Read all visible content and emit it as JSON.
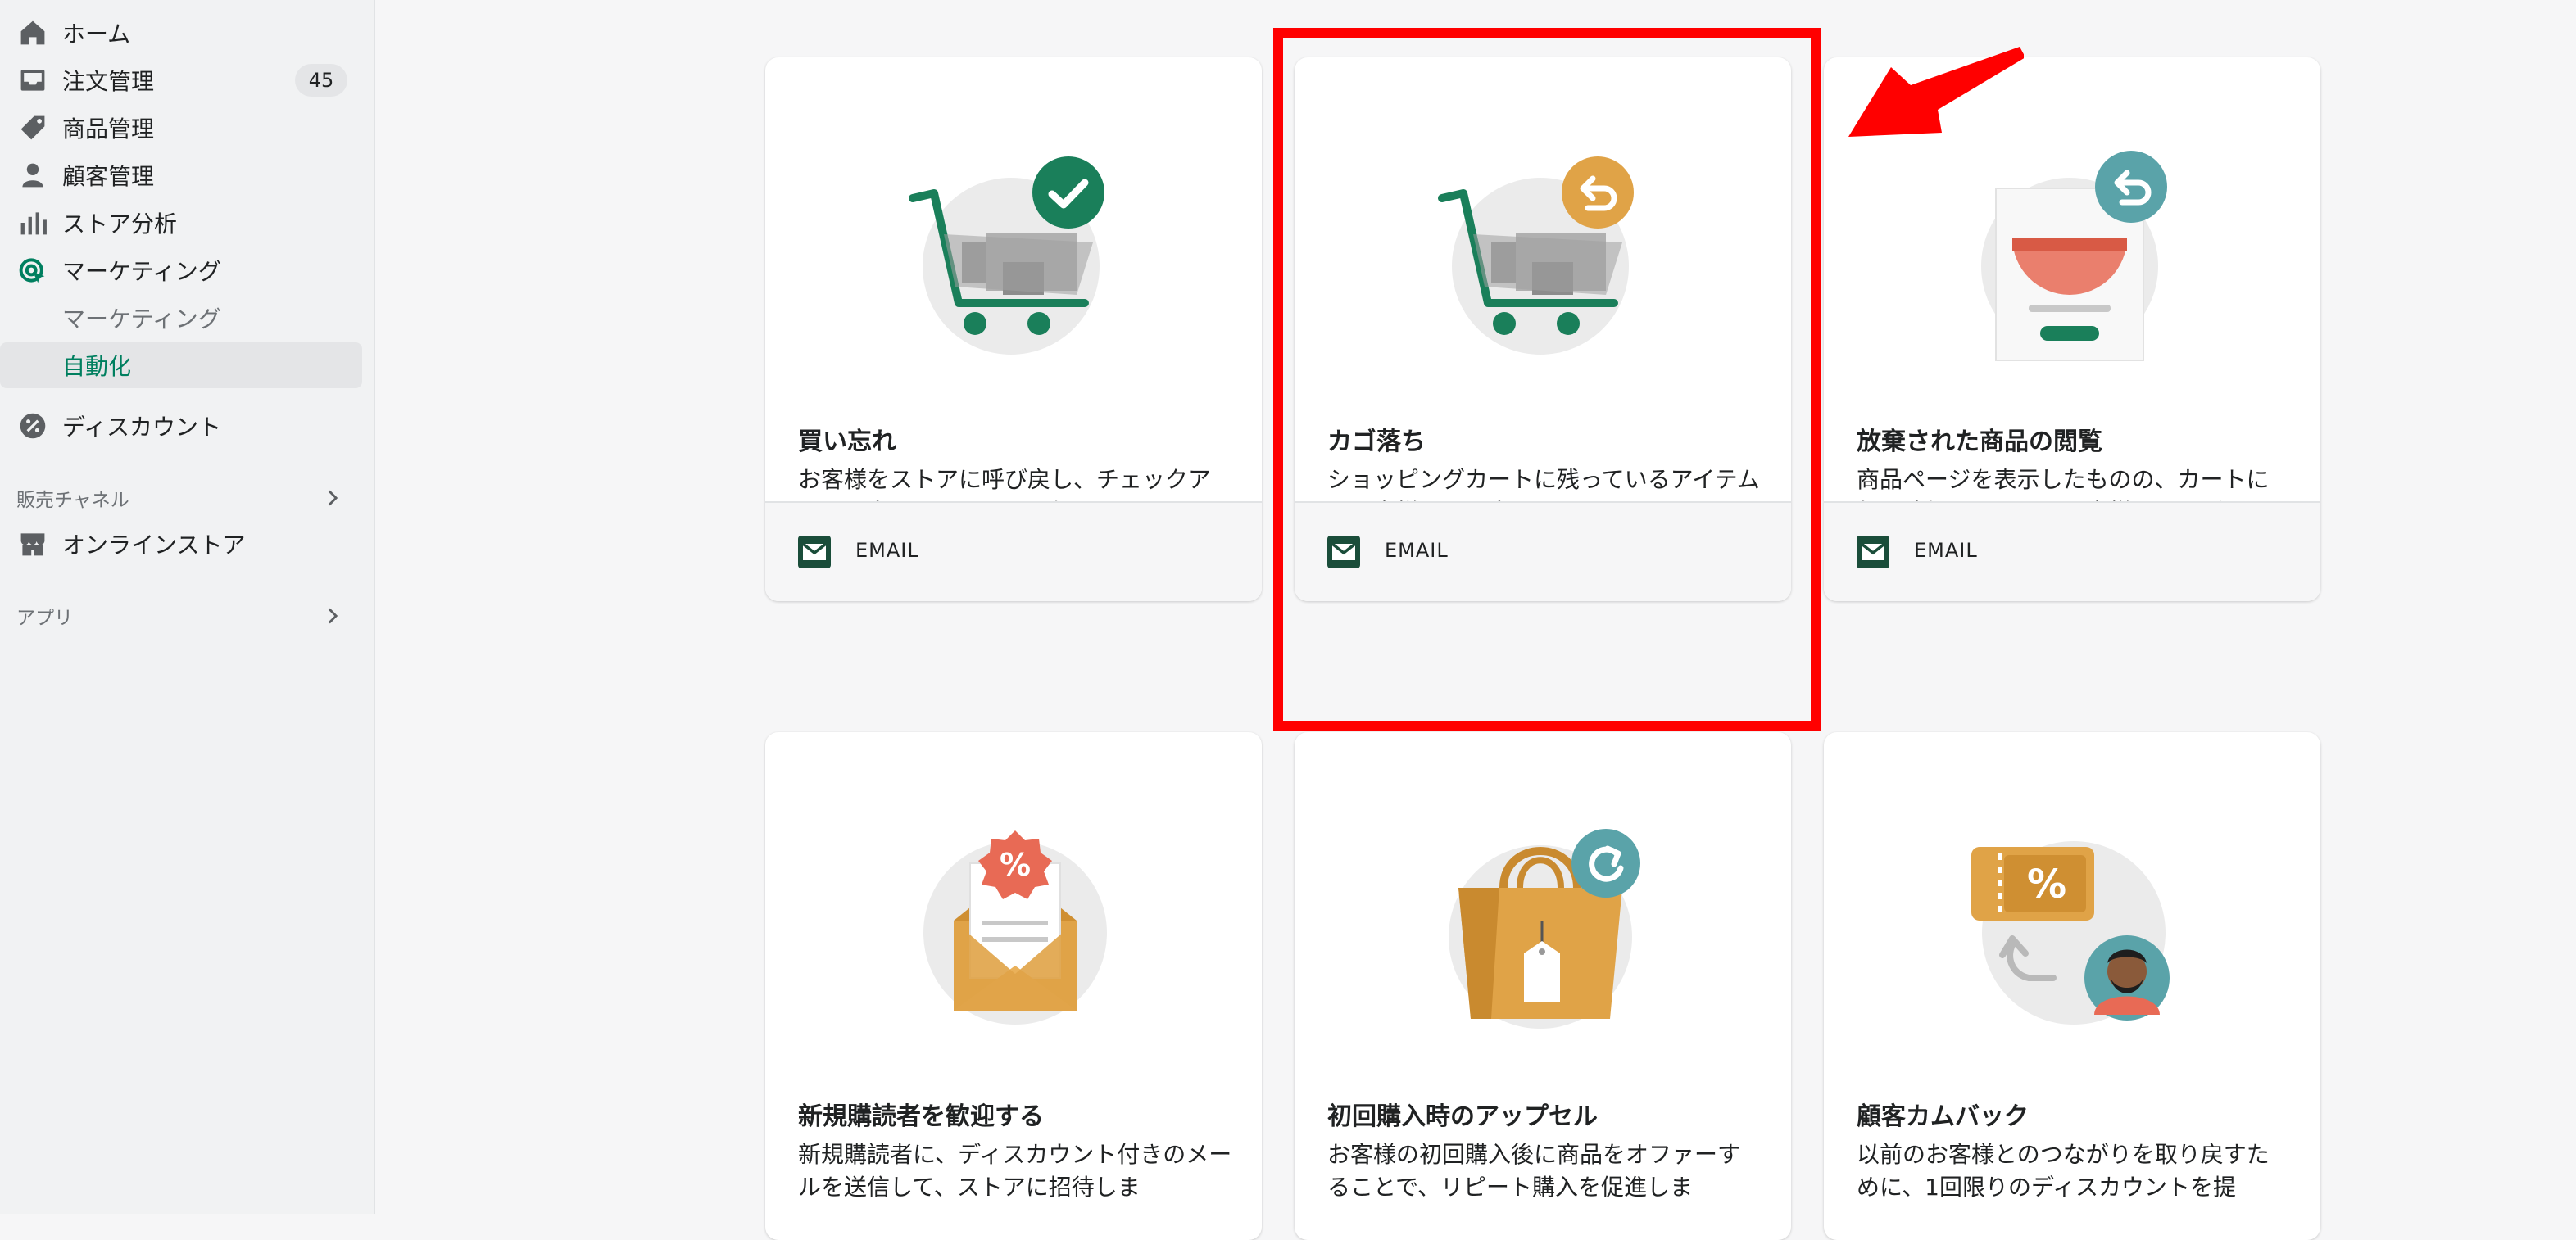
{
  "sidebar": {
    "items": [
      {
        "label": "ホーム",
        "icon": "home-icon"
      },
      {
        "label": "注文管理",
        "icon": "inbox-icon",
        "badge": "45"
      },
      {
        "label": "商品管理",
        "icon": "tag-icon"
      },
      {
        "label": "顧客管理",
        "icon": "person-icon"
      },
      {
        "label": "ストア分析",
        "icon": "bar-chart-icon"
      },
      {
        "label": "マーケティング",
        "icon": "marketing-target-icon"
      },
      {
        "label": "マーケティング"
      },
      {
        "label": "自動化",
        "active": true
      },
      {
        "label": "ディスカウント",
        "icon": "discount-icon"
      }
    ],
    "sales_channels": {
      "label": "販売チャネル",
      "items": [
        {
          "label": "オンラインストア",
          "icon": "store-icon"
        }
      ]
    },
    "apps": {
      "label": "アプリ"
    }
  },
  "cards": [
    {
      "title": "買い忘れ",
      "description": "お客様をストアに呼び戻し、チェックアウトを完了をするように促します。",
      "channel": "EMAIL",
      "illustration": "cart-check-illustration"
    },
    {
      "title": "カゴ落ち",
      "description": "ショッピングカートに残っているアイテムをお客様に思い出させましょう。",
      "channel": "EMAIL",
      "illustration": "cart-return-illustration"
    },
    {
      "title": "放棄された商品の閲覧",
      "description": "商品ページを表示したものの、カートに何も追加しなかったお客様のエンゲージメントを高めます。",
      "channel": "EMAIL",
      "illustration": "product-page-return-illustration"
    },
    {
      "title": "新規購読者を歓迎する",
      "description": "新規購読者に、ディスカウント付きのメールを送信して、ストアに招待しま",
      "illustration": "envelope-discount-illustration"
    },
    {
      "title": "初回購入時のアップセル",
      "description": "お客様の初回購入後に商品をオファーすることで、リピート購入を促進しま",
      "illustration": "shopping-bag-illustration"
    },
    {
      "title": "顧客カムバック",
      "description": "以前のお客様とのつながりを取り戻すために、1回限りのディスカウントを提",
      "illustration": "coupon-customer-illustration"
    }
  ],
  "colors": {
    "accent_green": "#007f5f",
    "annotation_red": "#ff0000",
    "illustration_green": "#1a7f5a",
    "illustration_orange": "#e0a347",
    "illustration_teal": "#5aa3a9",
    "illustration_coral": "#e86a55"
  }
}
